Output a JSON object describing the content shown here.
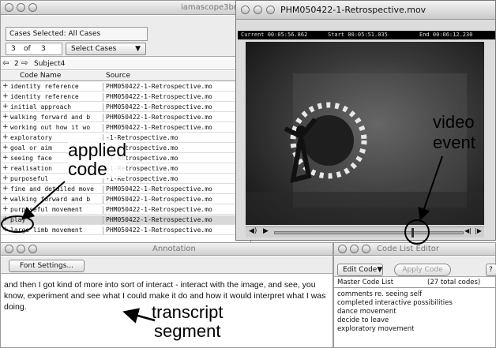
{
  "main_window": {
    "title": "iamascope3bmc",
    "cases_selected_label": "Cases Selected:  All Cases",
    "counter_current": "3",
    "counter_of": "of",
    "counter_total": "3",
    "select_cases_label": "Select Cases",
    "nav_number": "2",
    "subject_label": "Subject4",
    "col_code_name": "Code Name",
    "col_source": "Source",
    "rows": [
      {
        "mark": "+",
        "code": "identity reference",
        "src": "PHM050422-1-Retrospective.mo"
      },
      {
        "mark": "+",
        "code": "identity reference",
        "src": "PHM050422-1-Retrospective.mo"
      },
      {
        "mark": "+",
        "code": "initial approach",
        "src": "PHM050422-1-Retrospective.mo"
      },
      {
        "mark": "+",
        "code": "walking forward and b",
        "src": "PHM050422-1-Retrospective.mo"
      },
      {
        "mark": "+",
        "code": "working out how it wo",
        "src": "PHM050422-1-Retrospective.mo"
      },
      {
        "mark": "+",
        "code": "exploratory",
        "src": "-1-Retrospective.mo"
      },
      {
        "mark": "+",
        "code": "goal or aim",
        "src": "-1-Retrospective.mo"
      },
      {
        "mark": "+",
        "code": "seeing face",
        "src": "-1-Retrospective.mo"
      },
      {
        "mark": "+",
        "code": "realisation",
        "src": "-1-Retrospective.mo"
      },
      {
        "mark": "+",
        "code": "purposeful",
        "src": "-1-Retrospective.mo"
      },
      {
        "mark": "+",
        "code": "fine and detailed move",
        "src": "PHM050422-1-Retrospective.mo"
      },
      {
        "mark": "+",
        "code": "walking forward and b",
        "src": "PHM050422-1-Retrospective.mo"
      },
      {
        "mark": "+",
        "code": "purposeful movement",
        "src": "PHM050422-1-Retrospective.mo"
      },
      {
        "mark": "+",
        "code": "play",
        "src": "PHM050422-1-Retrospective.mo"
      },
      {
        "mark": "+",
        "code": "large limb movement",
        "src": "PHM050422-1-Retrospective.mo"
      }
    ]
  },
  "video_window": {
    "title": "PHM050422-1-Retrospective.mov",
    "current_label": "Current 00:05:56.862",
    "start_label": "Start 00:05:51.035",
    "end_label": "End  00:06:12.230"
  },
  "annotation_window": {
    "title": "Annotation",
    "font_settings_label": "Font Settings...",
    "text": "and then I got kind of more into sort of interact - interact with the image, and see, you know, experiment and see what I could make it do and how it would interpret what I was doing."
  },
  "code_list_editor": {
    "title": "Code List Editor",
    "edit_code_label": "Edit Code",
    "apply_code_label": "Apply Code",
    "help_label": "?",
    "master_label": "Master Code List",
    "total_label": "(27 total codes)",
    "codes": [
      "comments re. seeing self",
      "completed interactive possibilities",
      "dance movement",
      "decide to leave",
      "exploratory movement"
    ]
  },
  "callouts": {
    "applied_code": "applied\ncode",
    "video_event": "video\nevent",
    "transcript_segment": "transcript\nsegment"
  }
}
